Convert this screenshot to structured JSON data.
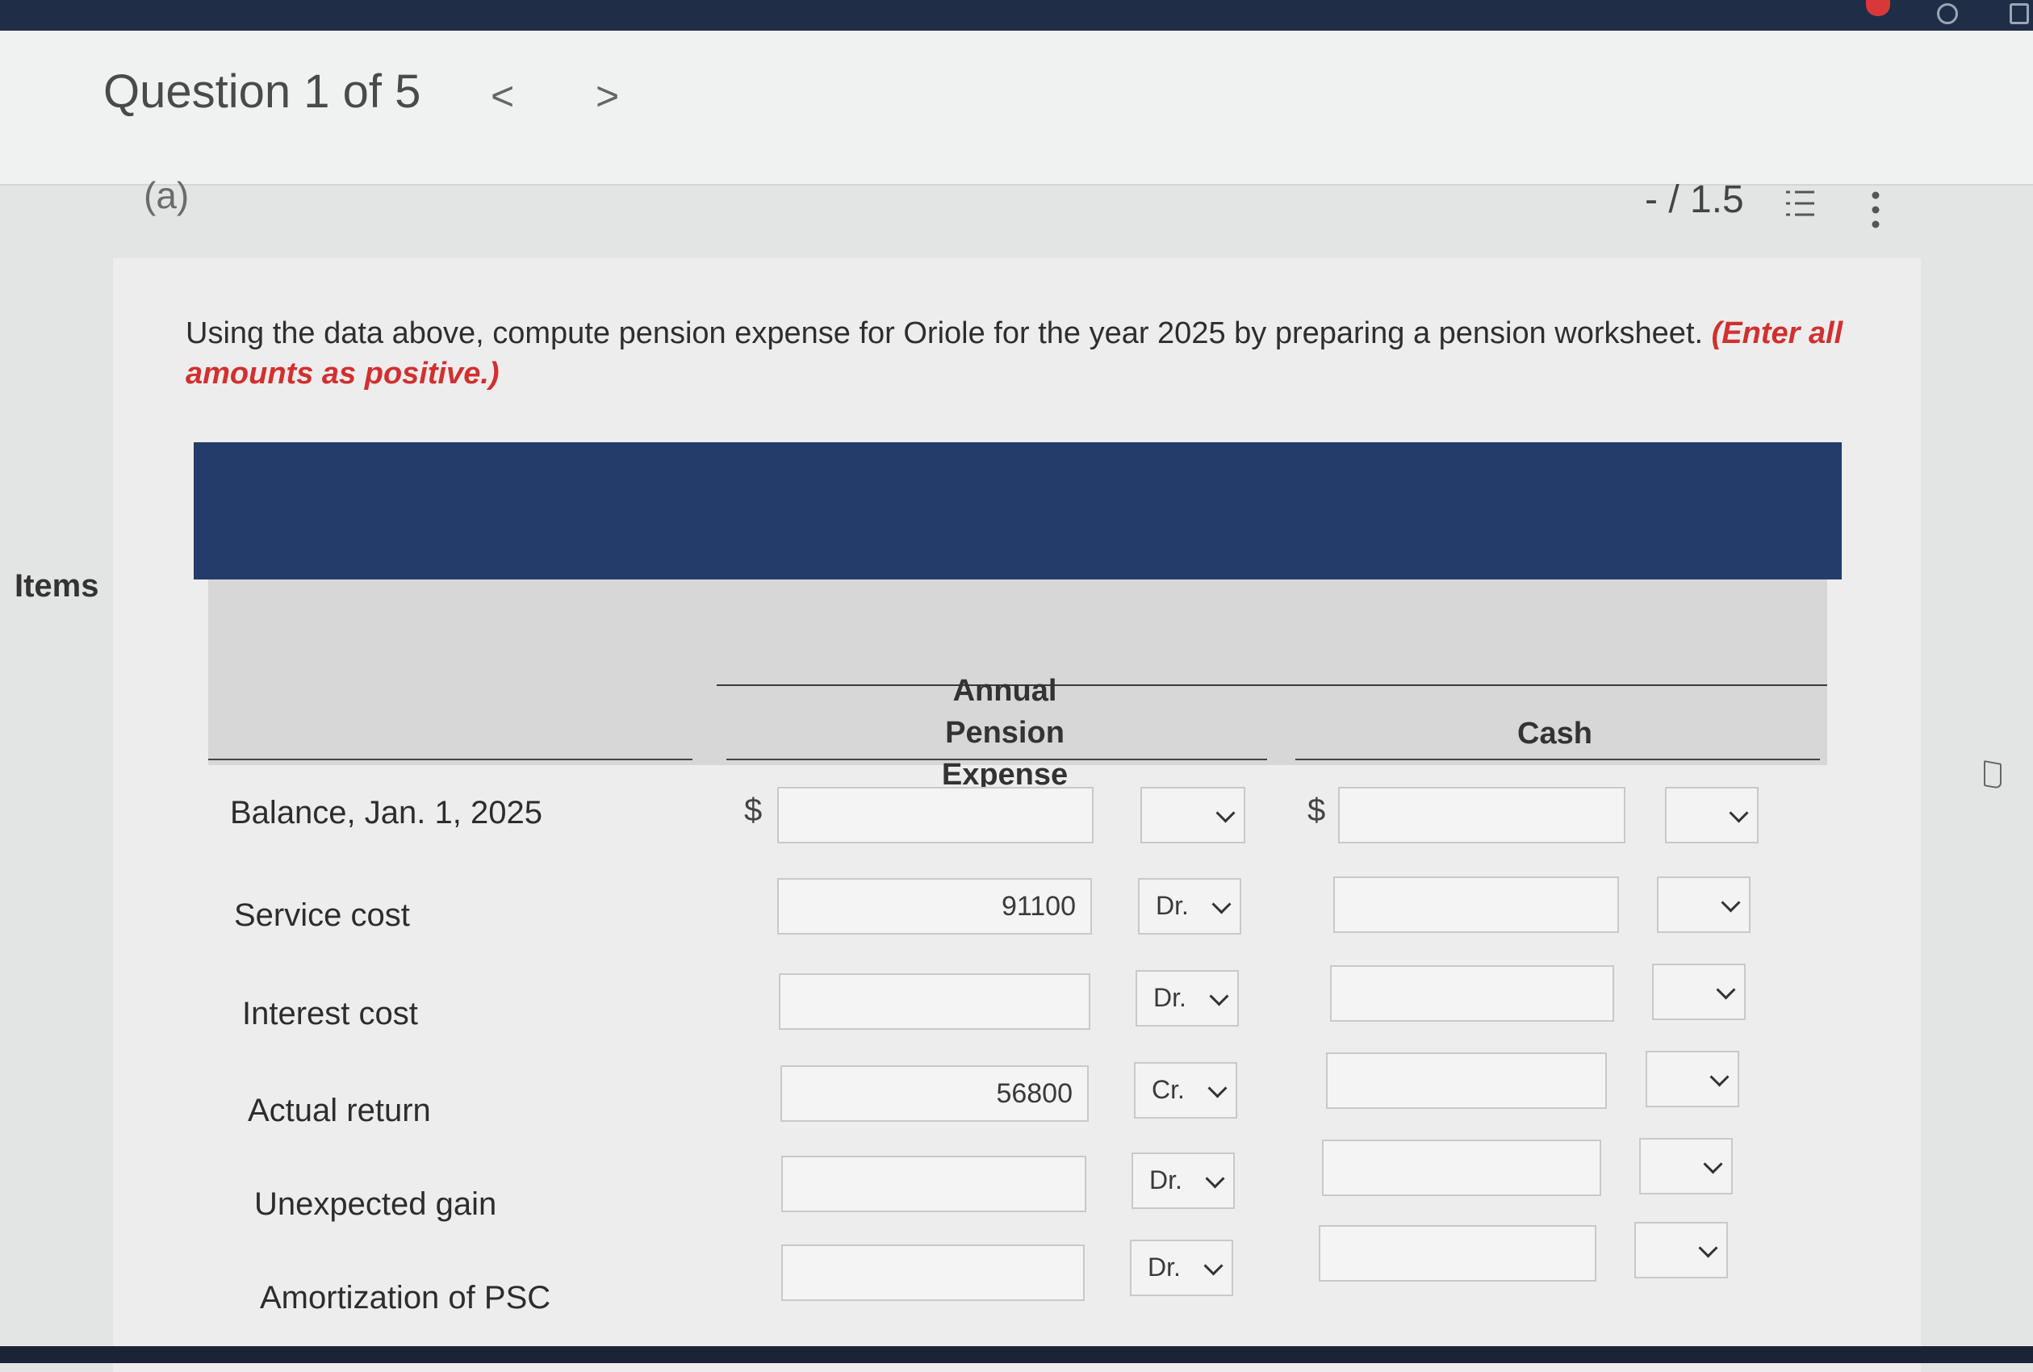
{
  "header": {
    "question_title": "Question 1 of 5",
    "prev_symbol": "<",
    "next_symbol": ">",
    "section": "(a)",
    "points": "- / 1.5"
  },
  "prompt": {
    "text": "Using the data above, compute pension expense for Oriole for the year 2025 by preparing a pension worksheet. ",
    "note": "(Enter all amounts as positive.)"
  },
  "table": {
    "col_items": "Items",
    "col_ape": "Annual Pension Expense",
    "col_cash": "Cash",
    "currency": "$",
    "rows": [
      {
        "label": "Balance, Jan. 1, 2025",
        "ape_value": "",
        "ape_drcr": "",
        "cash_value": "",
        "cash_drcr": ""
      },
      {
        "label": "Service cost",
        "ape_value": "91100",
        "ape_drcr": "Dr.",
        "cash_value": "",
        "cash_drcr": ""
      },
      {
        "label": "Interest cost",
        "ape_value": "",
        "ape_drcr": "Dr.",
        "cash_value": "",
        "cash_drcr": ""
      },
      {
        "label": "Actual return",
        "ape_value": "56800",
        "ape_drcr": "Cr.",
        "cash_value": "",
        "cash_drcr": ""
      },
      {
        "label": "Unexpected gain",
        "ape_value": "",
        "ape_drcr": "Dr.",
        "cash_value": "",
        "cash_drcr": ""
      },
      {
        "label": "Amortization of PSC",
        "ape_value": "",
        "ape_drcr": "Dr.",
        "cash_value": "",
        "cash_drcr": ""
      }
    ]
  },
  "icons": {
    "list": "numbered-list-icon",
    "more": "more-vertical-icon"
  },
  "colors": {
    "banner": "#243c69",
    "accent_red": "#d1302f"
  }
}
